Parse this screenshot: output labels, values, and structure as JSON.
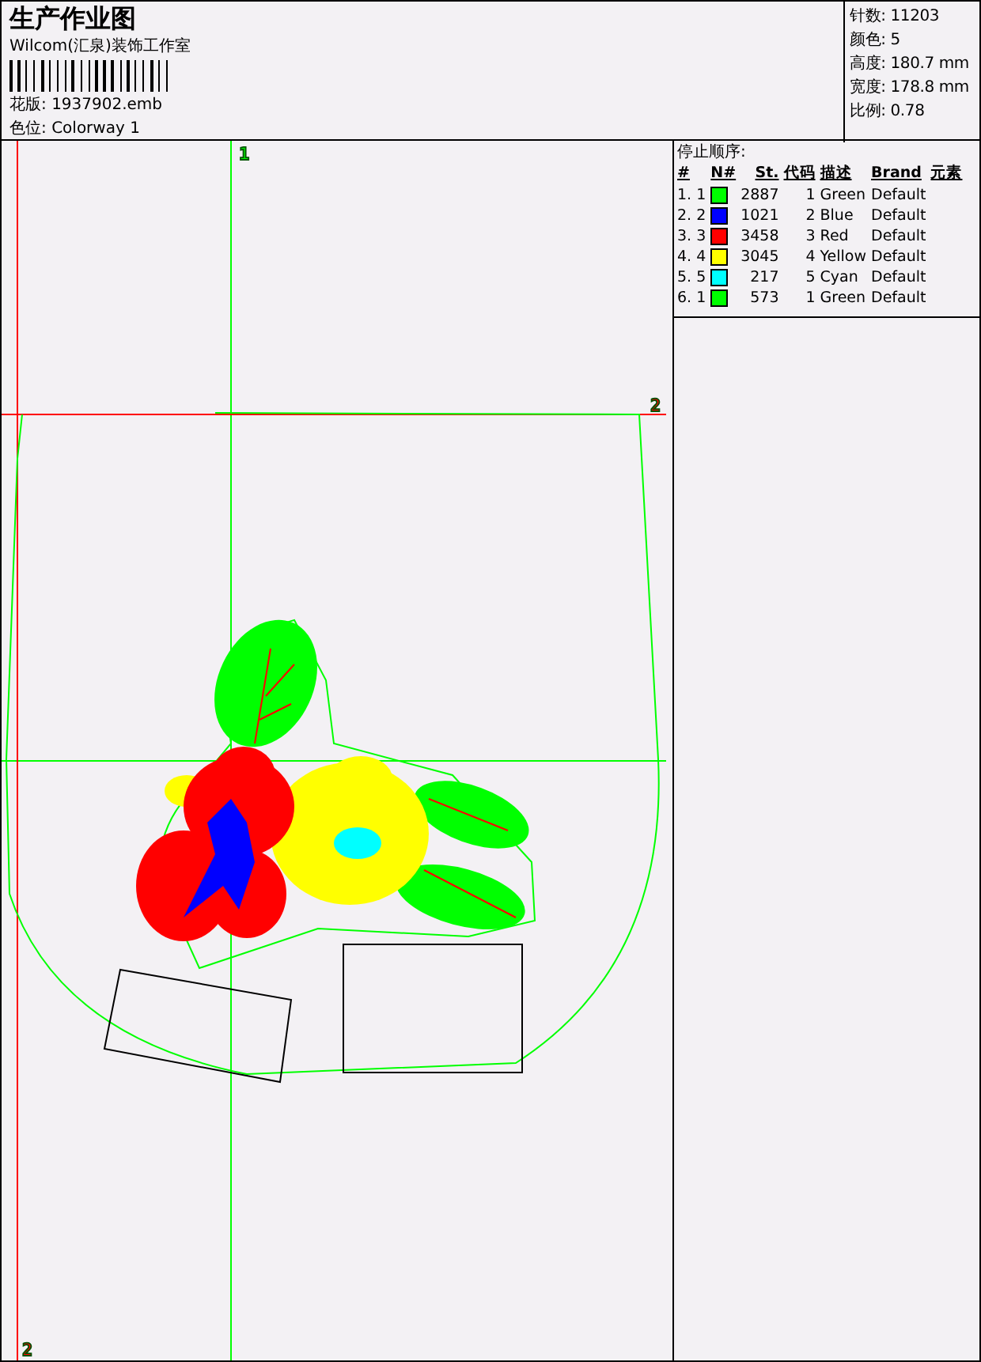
{
  "header": {
    "title": "生产作业图",
    "company": "Wilcom(汇泉)装饰工作室",
    "design": {
      "label": "花版:",
      "value": "1937902.emb"
    },
    "colorway": {
      "label": "色位:",
      "value": "Colorway 1"
    }
  },
  "summary": [
    {
      "label": "针数:",
      "value": "11203"
    },
    {
      "label": "颜色:",
      "value": "5"
    },
    {
      "label": "高度:",
      "value": "180.7 mm"
    },
    {
      "label": "宽度:",
      "value": "178.8 mm"
    },
    {
      "label": "比例:",
      "value": "0.78"
    }
  ],
  "stop_sequence": {
    "title": "停止顺序:",
    "columns": [
      "#",
      "N#",
      "St.",
      "代码",
      "描述",
      "Brand",
      "元素"
    ],
    "rows": [
      {
        "index": "1.",
        "needle": "1",
        "color": "#00ff00",
        "stitches": "2887",
        "code": "1",
        "description": "Green",
        "brand": "Default"
      },
      {
        "index": "2.",
        "needle": "2",
        "color": "#0000ff",
        "stitches": "1021",
        "code": "2",
        "description": "Blue",
        "brand": "Default"
      },
      {
        "index": "3.",
        "needle": "3",
        "color": "#ff0000",
        "stitches": "3458",
        "code": "3",
        "description": "Red",
        "brand": "Default"
      },
      {
        "index": "4.",
        "needle": "4",
        "color": "#ffff00",
        "stitches": "3045",
        "code": "4",
        "description": "Yellow",
        "brand": "Default"
      },
      {
        "index": "5.",
        "needle": "5",
        "color": "#00ffff",
        "stitches": "217",
        "code": "5",
        "description": "Cyan",
        "brand": "Default"
      },
      {
        "index": "6.",
        "needle": "1",
        "color": "#00ff00",
        "stitches": "573",
        "code": "1",
        "description": "Green",
        "brand": "Default"
      }
    ]
  },
  "canvas": {
    "guides": [
      {
        "label": "1",
        "color": "#00ff00"
      },
      {
        "label": "2",
        "color": "#ff0000"
      },
      {
        "label": "2",
        "color": "#ff0000"
      }
    ]
  }
}
